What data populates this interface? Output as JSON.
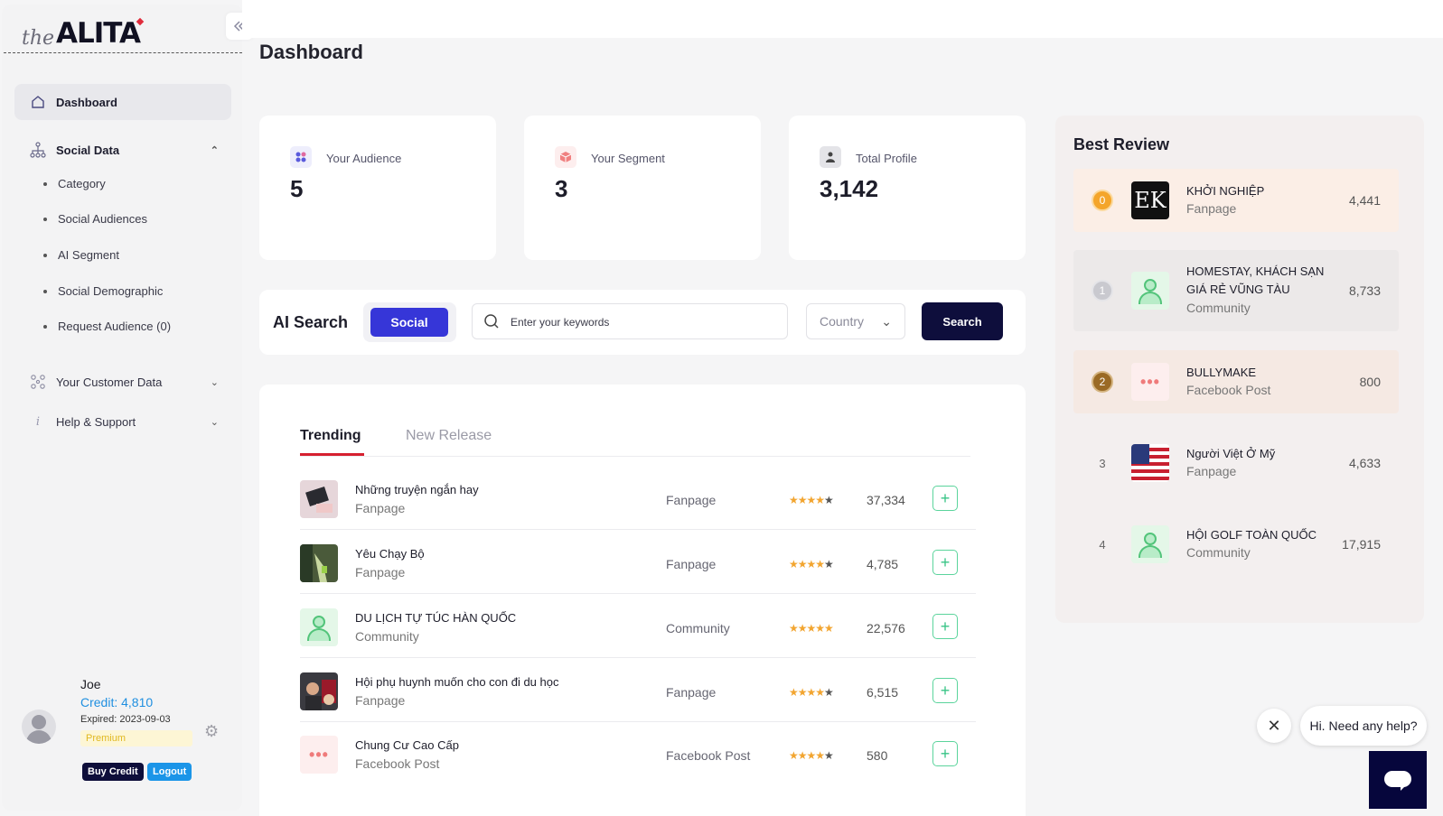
{
  "sidebar": {
    "logo_the": "the",
    "logo_alita": "ALITA",
    "collapse_icon": "double-chevron-left",
    "nav": {
      "dashboard": "Dashboard",
      "social_data": "Social Data",
      "your_customer_data": "Your Customer Data",
      "help_support": "Help & Support"
    },
    "social_sub": [
      "Category",
      "Social Audiences",
      "AI Segment",
      "Social Demographic",
      "Request Audience (0)"
    ],
    "user": {
      "name": "Joe",
      "credit": "Credit: 4,810",
      "expired": "Expired: 2023-09-03",
      "plan": "Premium",
      "buy_credit": "Buy Credit",
      "logout": "Logout"
    }
  },
  "header": {
    "title": "Dashboard"
  },
  "stats": [
    {
      "label": "Your Audience",
      "value": "5",
      "icon": "grid-icon"
    },
    {
      "label": "Your Segment",
      "value": "3",
      "icon": "cube-icon"
    },
    {
      "label": "Total Profile",
      "value": "3,142",
      "icon": "users-icon"
    }
  ],
  "ai_search": {
    "title": "AI Search",
    "mode": "Social",
    "keywords_placeholder": "Enter your keywords",
    "country": "Country",
    "search_label": "Search"
  },
  "trending": {
    "tabs": [
      "Trending",
      "New Release"
    ],
    "rows": [
      {
        "name": "Những truyện ngắn hay",
        "sub": "Fanpage",
        "type": "Fanpage",
        "rating": 4,
        "count": "37,334"
      },
      {
        "name": "Yêu Chạy Bộ",
        "sub": "Fanpage",
        "type": "Fanpage",
        "rating": 4,
        "count": "4,785"
      },
      {
        "name": "DU LỊCH TỰ TÚC HÀN QUỐC",
        "sub": "Community",
        "type": "Community",
        "rating": 5,
        "count": "22,576"
      },
      {
        "name": "Hội phụ huynh muốn cho con đi du học",
        "sub": "Fanpage",
        "type": "Fanpage",
        "rating": 4,
        "count": "6,515"
      },
      {
        "name": "Chung Cư Cao Cấp",
        "sub": "Facebook Post",
        "type": "Facebook Post",
        "rating": 4,
        "count": "580"
      }
    ]
  },
  "best_review": {
    "title": "Best Review",
    "items": [
      {
        "rank": "0",
        "name": "KHỞI NGHIỆP",
        "sub": "Fanpage",
        "count": "4,441",
        "thumb_text": "EK"
      },
      {
        "rank": "1",
        "name": "HOMESTAY, KHÁCH SẠN GIÁ RẺ VŨNG TÀU",
        "sub": "Community",
        "count": "8,733"
      },
      {
        "rank": "2",
        "name": "BULLYMAKE",
        "sub": "Facebook Post",
        "count": "800"
      },
      {
        "rank": "3",
        "name": "Người Việt Ở Mỹ",
        "sub": "Fanpage",
        "count": "4,633"
      },
      {
        "rank": "4",
        "name": "HỘI GOLF TOÀN QUỐC",
        "sub": "Community",
        "count": "17,915"
      }
    ]
  },
  "chat": {
    "greeting": "Hi. Need any help?"
  },
  "colors": {
    "primary": "#3636d8",
    "dark": "#0e0e3c",
    "accent": "#d62030",
    "credit": "#1f8fe0",
    "star": "#f2a530",
    "add": "#38c486"
  }
}
